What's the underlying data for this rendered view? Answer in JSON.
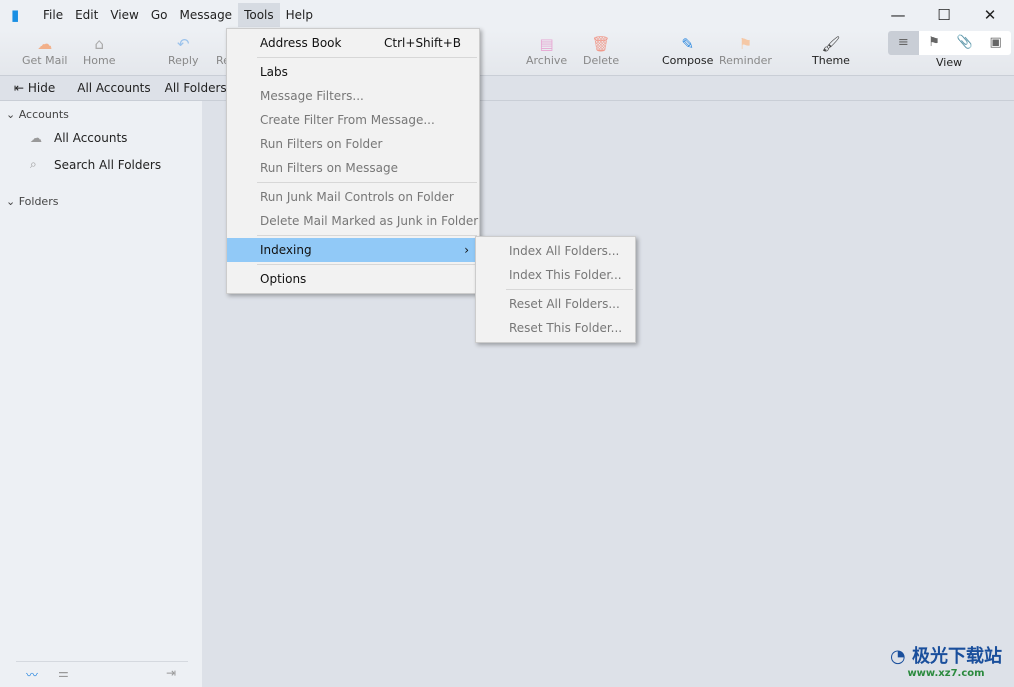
{
  "menubar": {
    "items": [
      "File",
      "Edit",
      "View",
      "Go",
      "Message",
      "Tools",
      "Help"
    ]
  },
  "window_controls": {
    "minimize": "—",
    "maximize": "☐",
    "close": "✕"
  },
  "toolbar": {
    "buttons": [
      {
        "label": "Get Mail",
        "icon": "cloud-download-icon",
        "glyph": "☁",
        "color": "#f2b08a"
      },
      {
        "label": "Home",
        "icon": "home-icon",
        "glyph": "⌂",
        "color": "#aaa"
      },
      {
        "label": "Reply",
        "icon": "reply-icon",
        "glyph": "↶",
        "color": "#9cc3ec"
      },
      {
        "label": "Re",
        "icon": "reply-all-icon",
        "glyph": "",
        "color": "#aaa"
      },
      {
        "label": "Archive",
        "icon": "archive-icon",
        "glyph": "▤",
        "color": "#e7a6d3"
      },
      {
        "label": "Delete",
        "icon": "trash-icon",
        "glyph": "🗑",
        "color": "#f09a8c"
      },
      {
        "label": "Compose",
        "icon": "pencil-icon",
        "glyph": "✎",
        "color": "#2b88e0"
      },
      {
        "label": "Reminder",
        "icon": "flag-icon",
        "glyph": "⚑",
        "color": "#f5c8a6"
      },
      {
        "label": "Theme",
        "icon": "brush-icon",
        "glyph": "🖌",
        "color": "#444"
      }
    ],
    "view_label": "View",
    "view_icons": [
      "list-icon",
      "flag-icon",
      "paperclip-icon",
      "image-icon"
    ],
    "view_glyphs": [
      "≡",
      "⚑",
      "📎",
      "▣"
    ]
  },
  "bar2": {
    "hide": "Hide",
    "all_accounts": "All Accounts",
    "all_folders": "All Folders"
  },
  "sidebar": {
    "accounts_header": "Accounts",
    "items": [
      "All Accounts",
      "Search All Folders"
    ],
    "folders_header": "Folders"
  },
  "tools_menu": [
    {
      "label": "Address Book",
      "shortcut": "Ctrl+Shift+B",
      "enabled": true
    },
    {
      "sep": true
    },
    {
      "label": "Labs",
      "enabled": true
    },
    {
      "label": "Message Filters...",
      "enabled": false
    },
    {
      "label": "Create Filter From Message...",
      "enabled": false
    },
    {
      "label": "Run Filters on Folder",
      "enabled": false
    },
    {
      "label": "Run Filters on Message",
      "enabled": false
    },
    {
      "sep": true
    },
    {
      "label": "Run Junk Mail Controls on Folder",
      "enabled": false
    },
    {
      "label": "Delete Mail Marked as Junk in Folder",
      "enabled": false
    },
    {
      "sep": true
    },
    {
      "label": "Indexing",
      "enabled": true,
      "submenu": true,
      "highlighted": true
    },
    {
      "sep": true
    },
    {
      "label": "Options",
      "enabled": true
    }
  ],
  "indexing_submenu": [
    {
      "label": "Index All Folders...",
      "enabled": false
    },
    {
      "label": "Index This Folder...",
      "enabled": false
    },
    {
      "sep": true
    },
    {
      "label": "Reset All Folders...",
      "enabled": false
    },
    {
      "label": "Reset This Folder..."
    }
  ],
  "watermark": {
    "text": "极光下载站",
    "url": "www.xz7.com"
  }
}
